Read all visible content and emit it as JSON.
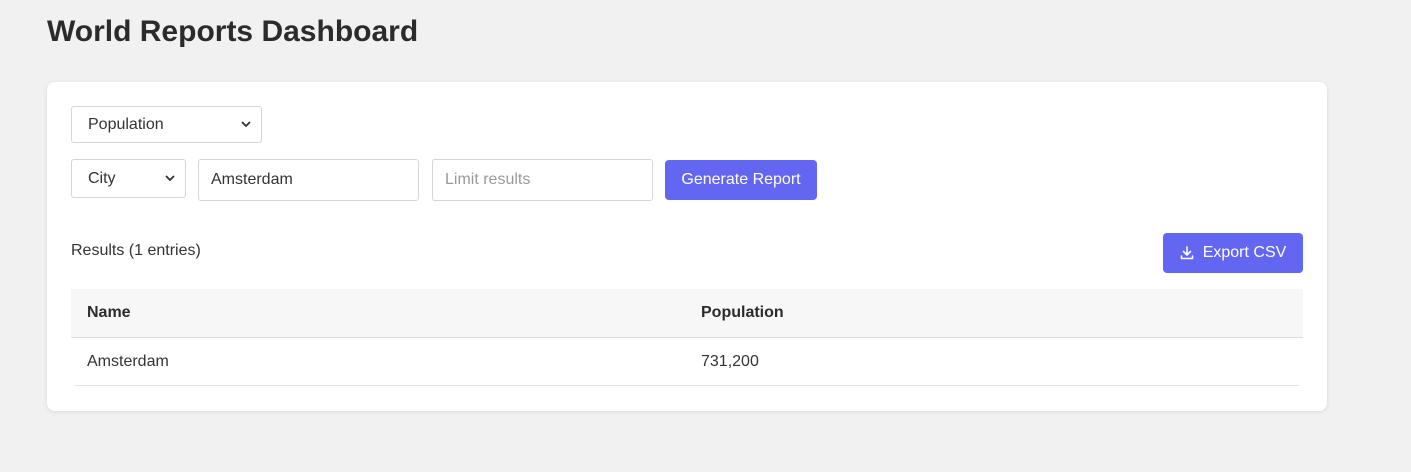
{
  "page": {
    "title": "World Reports Dashboard"
  },
  "filters": {
    "report_type": {
      "selected": "Population"
    },
    "scope": {
      "selected": "City"
    },
    "search_value": "Amsterdam",
    "limit_placeholder": "Limit results",
    "generate_label": "Generate Report"
  },
  "results": {
    "label": "Results (1 entries)",
    "export_label": "Export CSV",
    "columns": [
      "Name",
      "Population"
    ],
    "rows": [
      [
        "Amsterdam",
        "731,200"
      ]
    ]
  },
  "colors": {
    "accent": "#6366f1",
    "background": "#f1f1f1",
    "card": "#ffffff",
    "table_header": "#f6f7f6"
  }
}
